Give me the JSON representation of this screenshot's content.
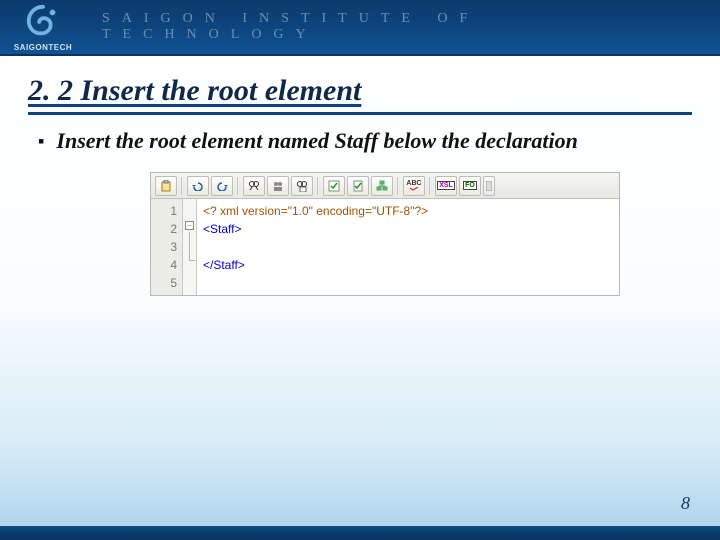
{
  "header": {
    "brand": "SAIGONTECH",
    "title": "SAIGON INSTITUTE OF TECHNOLOGY"
  },
  "heading": "2. 2 Insert the root element",
  "bullet": "Insert the root element named Staff below the declaration",
  "editor": {
    "lines": [
      "1",
      "2",
      "3",
      "4",
      "5"
    ],
    "code": {
      "l1": "<? xml version=\"1.0\" encoding=\"UTF-8\"?>",
      "l2": "<Staff>",
      "l4": "</Staff>"
    },
    "toolbar": {
      "abc": "ABC",
      "xsl": "XSL",
      "fo": "FO"
    }
  },
  "page": "8"
}
